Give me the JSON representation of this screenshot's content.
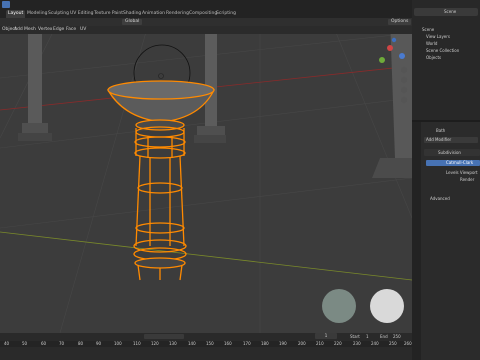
{
  "workspace_tabs": [
    "Layout",
    "Modeling",
    "Sculpting",
    "UV Editing",
    "Texture Paint",
    "Shading",
    "Animation",
    "Rendering",
    "Compositing",
    "Scripting"
  ],
  "header": {
    "transform_orientation": "Global",
    "options_label": "Options"
  },
  "viewport_menu": [
    "Object",
    "Add",
    "Mesh",
    "Vertex",
    "Edge",
    "Face",
    "UV"
  ],
  "outliner": {
    "search_scene": "Scene",
    "items": [
      "Scene",
      "View Layers",
      "World",
      "Scene Collection",
      "Objects"
    ]
  },
  "properties": {
    "object_name": "Bath",
    "add_modifier": "Add Modifier",
    "modifier_name": "Subdivision",
    "catmull_label": "Catmull-Clark",
    "levels_viewport": "Levels Viewport",
    "render_label": "Render",
    "advanced_label": "Advanced"
  },
  "timeline": {
    "start_label": "Start",
    "start_value": "1",
    "end_label": "End",
    "end_value": "250",
    "current_frame": "1",
    "ruler": [
      "40",
      "50",
      "60",
      "70",
      "80",
      "90",
      "100",
      "110",
      "120",
      "130",
      "140",
      "150",
      "160",
      "170",
      "180",
      "190",
      "200",
      "210",
      "220",
      "230",
      "240",
      "250",
      "260"
    ]
  },
  "colors": {
    "accent": "#4772b3",
    "selection": "#ff8a00",
    "active_tab": "#3d3d3d"
  }
}
